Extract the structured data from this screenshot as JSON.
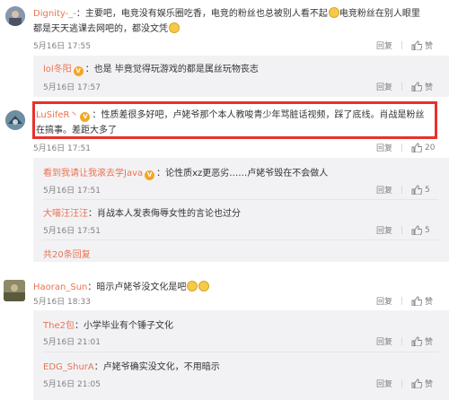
{
  "comments": [
    {
      "user": "Dignity-_-",
      "text1": "：主要吧，电竞没有娱乐圈吃香，电竞的粉丝也总被别人看不起",
      "text1b": "电竞粉丝在别人眼里",
      "text2": "都是天天逃课去网吧的，都没文凭",
      "time": "5月16日 17:55",
      "reply": "回复",
      "likes": "赞"
    },
    {
      "user": "lol冬阳",
      "text1": "：也是 毕竟觉得玩游戏的都是属丝玩物丧志",
      "time": "5月16日 17:57",
      "reply": "回复",
      "likes": "赞"
    },
    {
      "user": "LuSifeR丶",
      "text1": "：性质差很多好吧，卢姥爷那个本人教唆青少年骂脏话视频，踩了底线。肖战是粉丝",
      "text2": "在搞事。差距大多了",
      "time": "5月16日 17:51",
      "reply": "回复",
      "likes": "20"
    },
    {
      "user": "看到我请让我滚去学Java",
      "text1": "：论性质xz更恶劣……卢姥爷毁在不会做人",
      "time": "5月16日 17:51",
      "reply": "回复",
      "likes": "5"
    },
    {
      "user": "大喵汪汪汪",
      "text1": "：肖战本人发表侮辱女性的言论也过分",
      "time": "5月16日 17:51",
      "reply": "回复",
      "likes": "5"
    },
    {
      "more": "共20条回复"
    },
    {
      "user": "Haoran_Sun",
      "text1": "：暗示卢姥爷没文化是吧",
      "time": "5月16日 18:33",
      "reply": "回复",
      "likes": "赞"
    },
    {
      "user": "The2包",
      "text1": "：小学毕业有个锤子文化",
      "time": "5月16日 21:01",
      "reply": "回复",
      "likes": "赞"
    },
    {
      "user": "EDG_ShurA",
      "text1": "：卢姥爷确实没文化，不用暗示",
      "time": "5月16日 21:05",
      "reply": "回复",
      "likes": "赞"
    }
  ],
  "colors": {
    "highlight": "#e8312d",
    "username": "#eb7350",
    "reply_bg": "#f2f2f5"
  }
}
